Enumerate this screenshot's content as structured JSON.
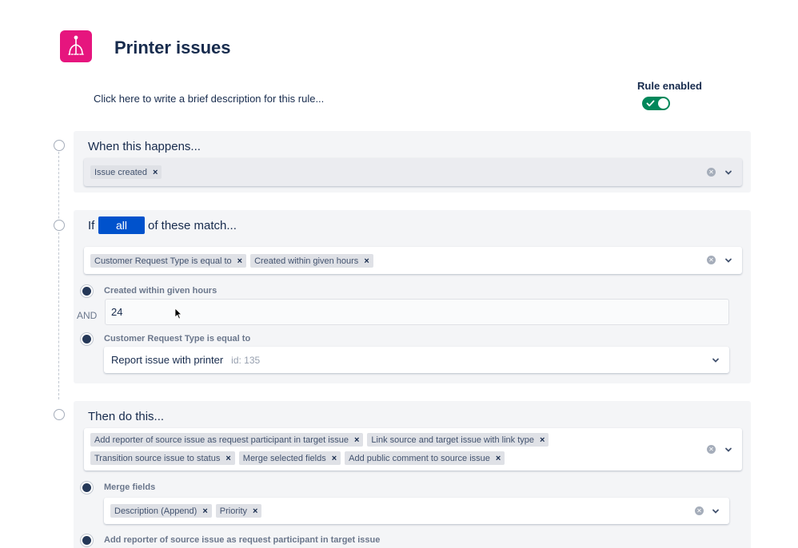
{
  "header": {
    "title": "Printer issues",
    "description": "Click here to write a brief description for this rule...",
    "rule_enabled_label": "Rule enabled",
    "rule_enabled": true,
    "icon": "automation-branch-icon",
    "icon_color": "#e6157e"
  },
  "trigger": {
    "heading": "When this happens...",
    "tags": [
      "Issue created"
    ]
  },
  "condition": {
    "heading_prefix": "If",
    "match_mode": "all",
    "heading_suffix": "of these match...",
    "tags": [
      "Customer Request Type is equal to",
      "Created within given hours"
    ],
    "joiner": "AND",
    "items": [
      {
        "label": "Created within given hours",
        "value": "24"
      },
      {
        "label": "Customer Request Type is equal to",
        "value": "Report issue with printer",
        "meta": "id: 135"
      }
    ]
  },
  "action": {
    "heading": "Then do this...",
    "tags": [
      "Add reporter of source issue as request participant in target issue",
      "Link source and target issue with link type",
      "Transition source issue to status",
      "Merge selected fields",
      "Add public comment to source issue"
    ],
    "items": [
      {
        "label": "Merge fields",
        "tags": [
          "Description (Append)",
          "Priority"
        ]
      },
      {
        "label": "Add reporter of source issue as request participant in target issue"
      }
    ]
  },
  "colors": {
    "primary": "#0052cc",
    "toggle_on": "#00875a",
    "section_bg": "#f4f5f7"
  }
}
